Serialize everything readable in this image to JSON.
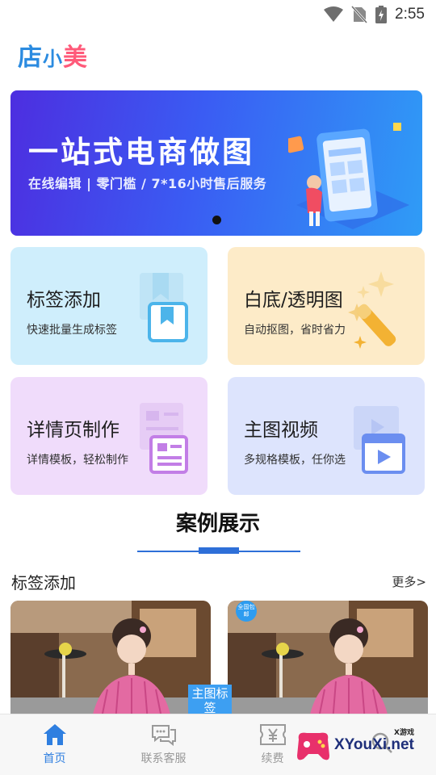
{
  "status_bar": {
    "time": "2:55",
    "icons": [
      "wifi-icon",
      "no-sim-icon",
      "battery-icon"
    ]
  },
  "header": {
    "logo_part1": "店",
    "logo_part2": "小",
    "logo_part3": "美"
  },
  "banner": {
    "title": "一站式电商做图",
    "subtitle": "在线编辑 | 零门槛 / 7*16小时售后服务",
    "page_count": 1,
    "active_page": 1
  },
  "features": [
    {
      "title": "标签添加",
      "subtitle": "快速批量生成标签",
      "icon": "bookmark-icon"
    },
    {
      "title": "白底/透明图",
      "subtitle": "自动抠图，省时省力",
      "icon": "magic-wand-icon"
    },
    {
      "title": "详情页制作",
      "subtitle": "详情模板，轻松制作",
      "icon": "document-icon"
    },
    {
      "title": "主图视频",
      "subtitle": "多规格模板，任你选",
      "icon": "video-clapper-icon"
    }
  ],
  "cases": {
    "section_title": "案例展示",
    "row_title": "标签添加",
    "more_label": "更多>",
    "thumb_tag": "主图标签",
    "mini_badge": "全国包邮"
  },
  "bottom_nav": [
    {
      "label": "首页",
      "icon": "home-icon",
      "active": true
    },
    {
      "label": "联系客服",
      "icon": "chat-icon",
      "active": false
    },
    {
      "label": "续费",
      "icon": "yen-ticket-icon",
      "active": false
    },
    {
      "label": "",
      "icon": "search-icon",
      "active": false
    }
  ],
  "watermark": {
    "text": "XYouXi.net",
    "small": "X游戏"
  },
  "colors": {
    "accent": "#2f7fe0",
    "banner_start": "#4d2ee0",
    "banner_end": "#2f9cf6"
  }
}
